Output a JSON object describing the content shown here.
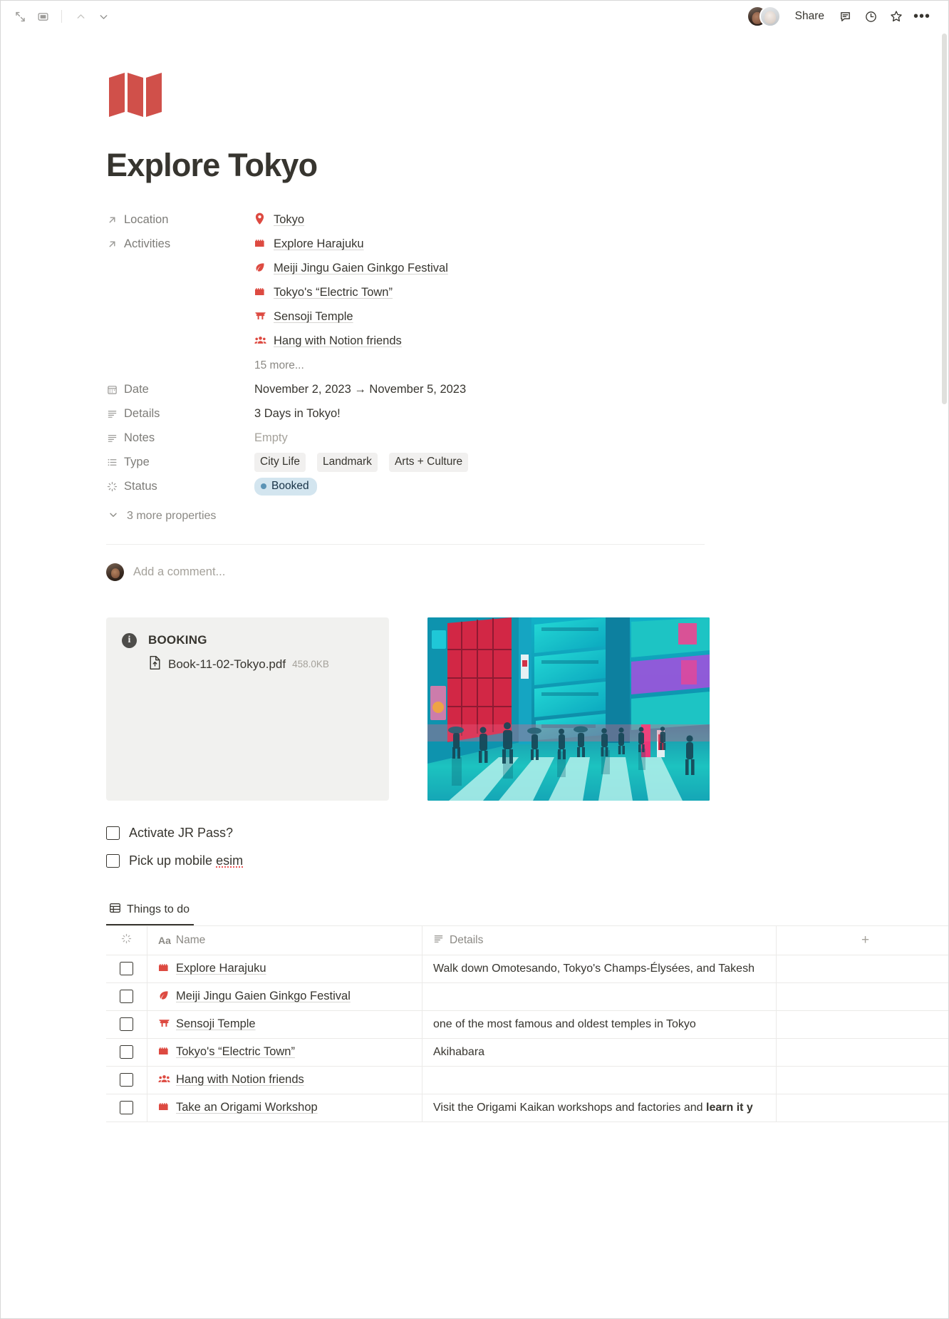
{
  "topbar": {
    "left_icons": [
      {
        "name": "expand-icon",
        "glyph": "expand"
      },
      {
        "name": "sidebar-toggle-icon",
        "glyph": "panel"
      }
    ],
    "nav": [
      {
        "name": "nav-up-icon",
        "glyph": "chevron-up"
      },
      {
        "name": "nav-down-icon",
        "glyph": "chevron-down"
      }
    ],
    "share_label": "Share",
    "right_icons": [
      {
        "name": "comment-icon"
      },
      {
        "name": "history-clock-icon"
      },
      {
        "name": "favorite-star-icon"
      },
      {
        "name": "more-options-icon"
      }
    ]
  },
  "page": {
    "icon_name": "folded-map-icon",
    "icon_color": "#d0504a",
    "title": "Explore Tokyo"
  },
  "properties": [
    {
      "label": "Location",
      "icon": "arrow-up-right-icon",
      "type": "relation",
      "values": [
        {
          "emoji": "location-pin",
          "text": "Tokyo"
        }
      ]
    },
    {
      "label": "Activities",
      "icon": "arrow-up-right-icon",
      "type": "relation",
      "values": [
        {
          "emoji": "castle",
          "text": "Explore Harajuku"
        },
        {
          "emoji": "leaf",
          "text": "Meiji Jingu Gaien Ginkgo Festival"
        },
        {
          "emoji": "castle",
          "text": "Tokyo's “Electric Town”"
        },
        {
          "emoji": "shrine",
          "text": "Sensoji Temple"
        },
        {
          "emoji": "people",
          "text": "Hang with Notion friends"
        }
      ],
      "more": "15 more..."
    },
    {
      "label": "Date",
      "icon": "calendar-icon",
      "type": "date",
      "text": "November 2, 2023 → November 5, 2023"
    },
    {
      "label": "Details",
      "icon": "text-lines-icon",
      "type": "text",
      "text": "3 Days in Tokyo!"
    },
    {
      "label": "Notes",
      "icon": "text-lines-icon",
      "type": "text",
      "text": "Empty",
      "empty": true
    },
    {
      "label": "Type",
      "icon": "list-icon",
      "type": "multi-select",
      "tags": [
        "City Life",
        "Landmark",
        "Arts + Culture"
      ]
    },
    {
      "label": "Status",
      "icon": "status-spinner-icon",
      "type": "status",
      "status": "Booked",
      "status_dot_color": "#5b93b5",
      "status_bg_color": "#d3e5ef"
    }
  ],
  "more_properties_label": "3 more properties",
  "comment": {
    "placeholder": "Add a comment..."
  },
  "callout": {
    "title": "BOOKING",
    "icon": "info-icon",
    "file_name": "Book-11-02-Tokyo.pdf",
    "file_size": "458.0KB",
    "file_icon": "pdf-upload-icon"
  },
  "photo": {
    "name": "tokyo-neon-street-photo",
    "alt": "Neon-lit Tokyo shopping street at night with pedestrians on a crosswalk"
  },
  "todos": [
    {
      "label": "Activate JR Pass?",
      "checked": false,
      "spellcheck_word": null
    },
    {
      "label": "Pick up mobile ",
      "checked": false,
      "spellcheck_word": "esim"
    }
  ],
  "database": {
    "tab_label": "Things to do",
    "tab_icon": "table-icon",
    "columns": [
      {
        "key": "check",
        "label": "",
        "icon": "status-spinner-icon"
      },
      {
        "key": "name",
        "label": "Name",
        "icon": "title-aa-icon"
      },
      {
        "key": "details",
        "label": "Details",
        "icon": "text-lines-icon"
      }
    ],
    "add_column_label": "+",
    "rows": [
      {
        "emoji": "castle",
        "name": "Explore Harajuku",
        "details": "Walk down Omotesando, Tokyo's Champs-Élysées, and Takesh",
        "details_bold": ""
      },
      {
        "emoji": "leaf",
        "name": "Meiji Jingu Gaien Ginkgo Festival",
        "details": "",
        "details_bold": ""
      },
      {
        "emoji": "shrine",
        "name": "Sensoji Temple",
        "details": "one of the most famous and oldest temples in Tokyo",
        "details_bold": ""
      },
      {
        "emoji": "castle",
        "name": "Tokyo's “Electric Town”",
        "details": "Akihabara",
        "details_bold": ""
      },
      {
        "emoji": "people",
        "name": "Hang with Notion friends",
        "details": "",
        "details_bold": ""
      },
      {
        "emoji": "castle",
        "name": "Take an Origami Workshop",
        "details": "Visit the Origami Kaikan workshops and factories and ",
        "details_bold": "learn it y"
      }
    ]
  }
}
